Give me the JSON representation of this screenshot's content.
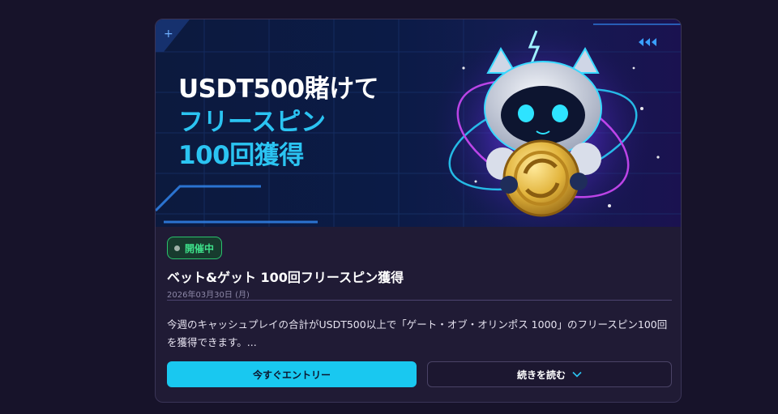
{
  "banner": {
    "headline_line1": "USDT500賭けて",
    "headline_line2": "フリースピン",
    "headline_line3": "100回獲得"
  },
  "promo": {
    "status_badge": "開催中",
    "title": "ベット&ゲット 100回フリースピン獲得",
    "date": "2026年03月30日 (月)",
    "description": "今週のキャッシュプレイの合計がUSDT500以上で「ゲート・オブ・オリンポス 1000」のフリースピン100回を獲得できます。..."
  },
  "actions": {
    "enter_label": "今すぐエントリー",
    "read_more_label": "続きを読む"
  },
  "colors": {
    "page_bg": "#17132a",
    "card_bg": "#201b35",
    "accent_cyan": "#19c8f0",
    "status_green": "#3ee08a"
  },
  "icons": {
    "read_more": "chevron-down-icon",
    "badge": "status-dot-icon"
  }
}
